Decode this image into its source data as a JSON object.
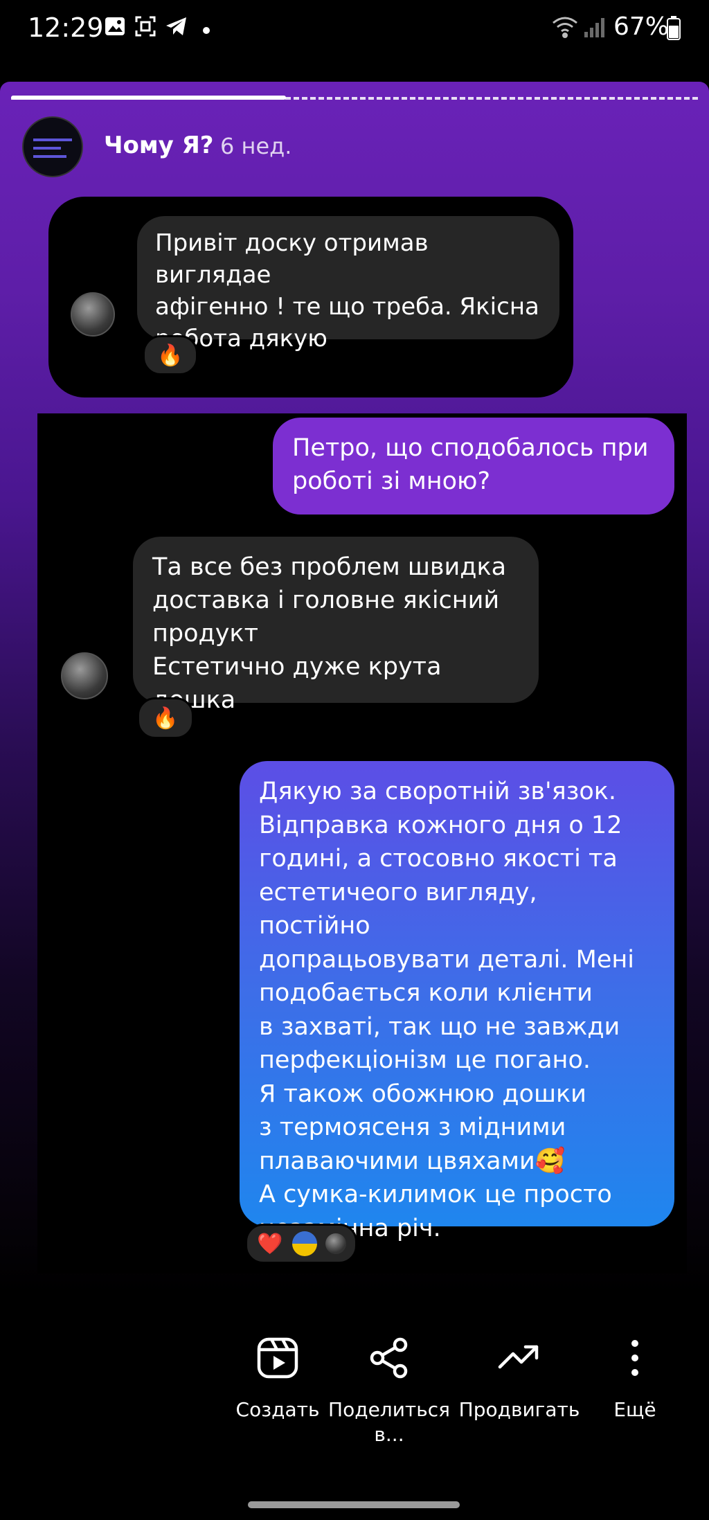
{
  "status_bar": {
    "time": "12:29",
    "battery": "67%"
  },
  "story": {
    "username": "Чому Я?",
    "posted_ago": "6 нед.",
    "progress": 0.4
  },
  "messages": {
    "m1": "Привіт доску отримав виглядае\nафігенно ! те що треба. Якісна\nробота дякую",
    "m1_reaction": "🔥",
    "m2": "Петро, що сподобалось при\nроботі зі мною?",
    "m3": "Та все без проблем швидка\nдоставка і головне якісний\nпродукт\nЕстетично дуже крута дошка",
    "m3_reaction": "🔥",
    "m4": "Дякую за сворот­ній зв'язок.\nВідправка кожного дня о 12\nгодині, а стосовно якості та\nестетичеого вигляду, постійно\nдопрацьовувати деталі. Мені\nподобається коли клієнти\nв захваті, так що не завжди\nперфекціонізм це погано.\nЯ також обожнюю дошки\nз термоясеня з мідними\nплаваючими цвяхами🥰\nА сумка-килимок це просто\nнезамінна річ.",
    "m4_reaction": "❤️"
  },
  "actions": {
    "create": "Создать",
    "share": "Поделиться\nв...",
    "promote": "Продвигать",
    "more": "Ещё"
  }
}
